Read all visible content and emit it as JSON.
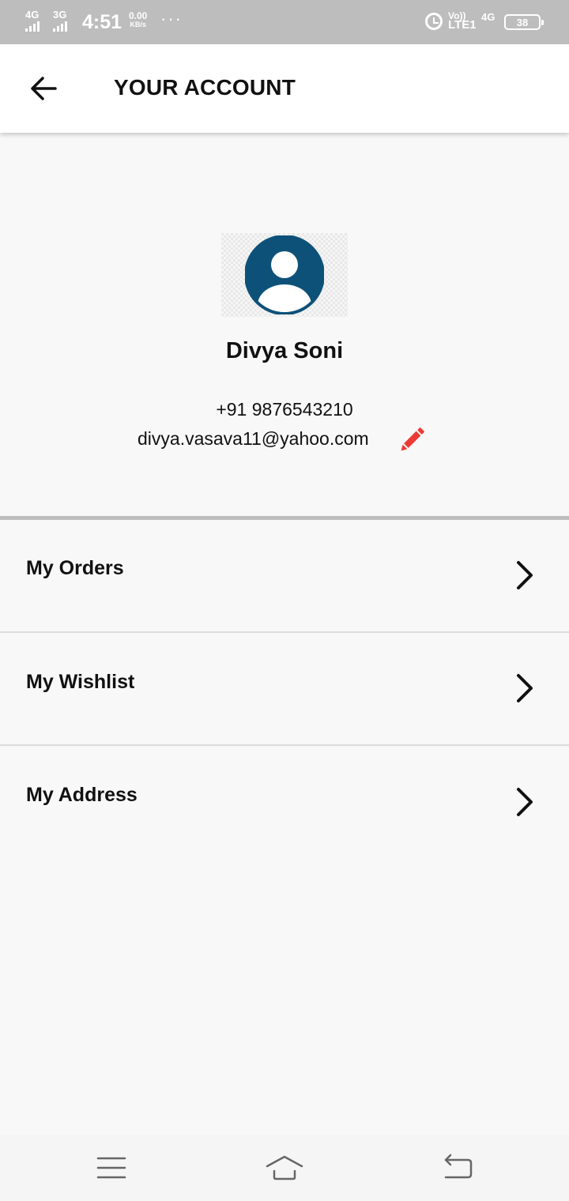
{
  "status_bar": {
    "sim1_network": "4G",
    "sim2_network": "3G",
    "time": "4:51",
    "speed_value": "0.00",
    "speed_unit": "KB/s",
    "more": "···",
    "volte": "Vo))",
    "lte": "LTE1",
    "network_right": "4G",
    "battery": "38"
  },
  "app_bar": {
    "title": "YOUR ACCOUNT",
    "back_icon": "arrow-left-icon"
  },
  "profile": {
    "name": "Divya Soni",
    "phone": "+91 9876543210",
    "email": "divya.vasava11@yahoo.com",
    "avatar_icon": "user-circle-icon",
    "edit_icon": "pencil-icon",
    "avatar_color": "#0d5178",
    "edit_color": "#ea3b34"
  },
  "menu": [
    {
      "label": "My Orders",
      "icon": "chevron-right-icon"
    },
    {
      "label": "My Wishlist",
      "icon": "chevron-right-icon"
    },
    {
      "label": "My Address",
      "icon": "chevron-right-icon"
    }
  ],
  "nav_bar": {
    "menu_icon": "hamburger-icon",
    "home_icon": "home-icon",
    "back_icon": "back-return-icon"
  }
}
